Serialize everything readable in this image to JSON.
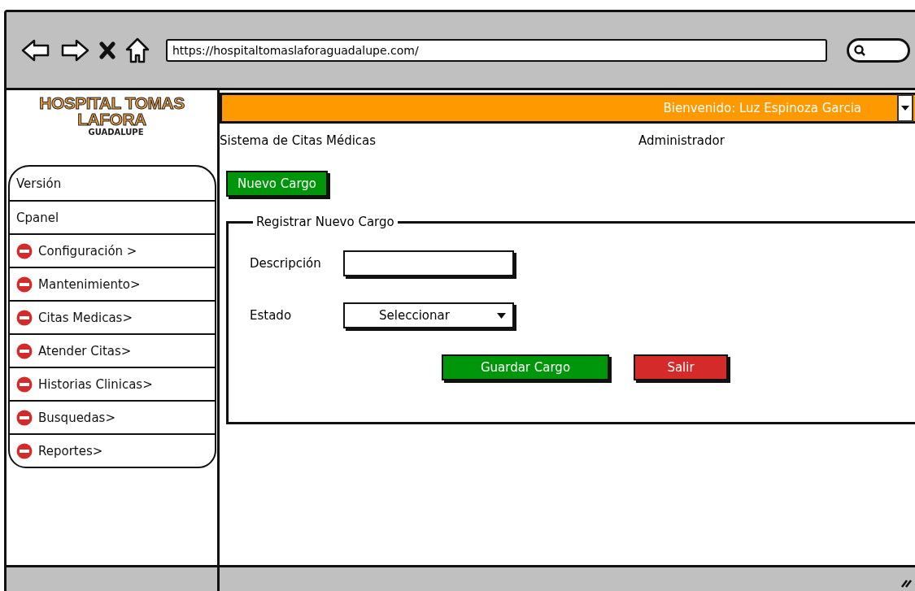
{
  "browser": {
    "url": "https://hospitaltomaslaforaguadalupe.com/"
  },
  "logo": {
    "title": "HOSPITAL TOMAS LAFORA",
    "subtitle": "GUADALUPE"
  },
  "header": {
    "welcome": "Bienvenido: Luz Espinoza Garcia"
  },
  "sidebar": {
    "items": [
      {
        "label": "Versión",
        "kind": "plain"
      },
      {
        "label": "Cpanel",
        "kind": "plain"
      },
      {
        "label": "Configuración >",
        "kind": "module"
      },
      {
        "label": "Mantenimiento>",
        "kind": "module"
      },
      {
        "label": "Citas Medicas>",
        "kind": "module"
      },
      {
        "label": "Atender Citas>",
        "kind": "module"
      },
      {
        "label": "Historias Clinicas>",
        "kind": "module"
      },
      {
        "label": "Busquedas>",
        "kind": "module"
      },
      {
        "label": "Reportes>",
        "kind": "module"
      }
    ]
  },
  "system_title": "Sistema de Citas Médicas",
  "role": "Administrador",
  "new_button": "Nuevo Cargo",
  "form": {
    "legend": "Registrar Nuevo Cargo",
    "fields": [
      {
        "label": "Descripción",
        "kind": "text"
      },
      {
        "label": "Estado",
        "kind": "select",
        "value": "Seleccionar"
      }
    ],
    "buttons": [
      {
        "label": "Guardar Cargo",
        "kind": "save"
      },
      {
        "label": "Salir",
        "kind": "exit"
      }
    ]
  }
}
